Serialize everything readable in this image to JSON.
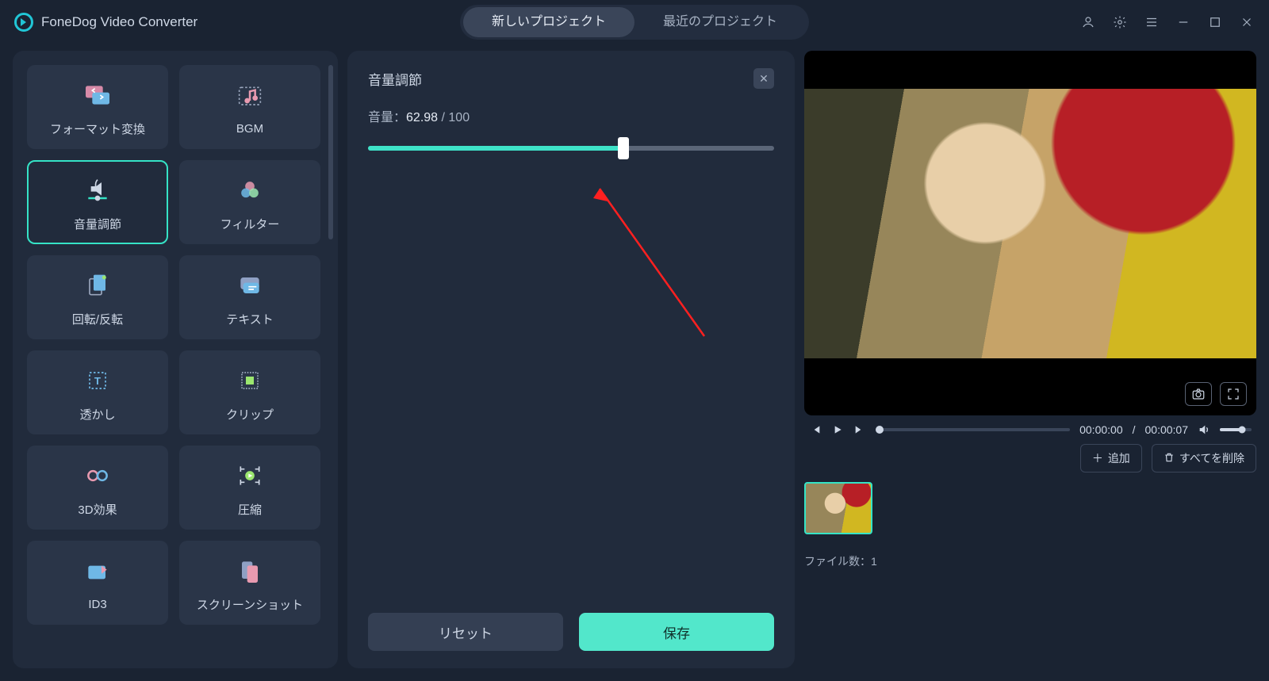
{
  "app_title": "FoneDog Video Converter",
  "tabs": {
    "new": "新しいプロジェクト",
    "recent": "最近のプロジェクト"
  },
  "tools": [
    {
      "id": "format",
      "label": "フォーマット変換"
    },
    {
      "id": "bgm",
      "label": "BGM"
    },
    {
      "id": "volume",
      "label": "音量調節"
    },
    {
      "id": "filter",
      "label": "フィルター"
    },
    {
      "id": "rotate",
      "label": "回転/反転"
    },
    {
      "id": "text",
      "label": "テキスト"
    },
    {
      "id": "watermark",
      "label": "透かし"
    },
    {
      "id": "clip",
      "label": "クリップ"
    },
    {
      "id": "3d",
      "label": "3D効果"
    },
    {
      "id": "compress",
      "label": "圧縮"
    },
    {
      "id": "id3",
      "label": "ID3"
    },
    {
      "id": "screenshot",
      "label": "スクリーンショット"
    }
  ],
  "panel": {
    "title": "音量調節",
    "volume_label": "音量：",
    "volume_value": "62.98",
    "volume_suffix": " / 100",
    "volume_percent": 62.98,
    "reset": "リセット",
    "save": "保存"
  },
  "transport": {
    "current": "00:00:00",
    "sep": " / ",
    "total": "00:00:07"
  },
  "actions": {
    "add": "追加",
    "delete_all": "すべてを削除"
  },
  "files": {
    "count_label": "ファイル数：",
    "count": "1"
  },
  "colors": {
    "accent": "#3ee2c8"
  }
}
